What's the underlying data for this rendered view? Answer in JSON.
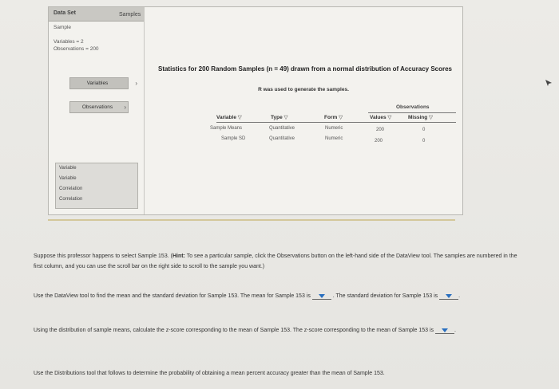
{
  "data_view": {
    "headers": {
      "data_set": "Data Set",
      "samples": "Samples"
    },
    "dataset_name": "Sample",
    "variables_line": "Variables = 2",
    "observations_line": "Observations = 200",
    "variables_button": "Variables",
    "observations_button": "Observations",
    "list_items": [
      "Variable",
      "Variable",
      "Correlation",
      "Correlation"
    ],
    "title": "Statistics for 200 Random Samples (n = 49) drawn from a normal distribution of Accuracy Scores",
    "subtitle": "R was used to generate the samples.",
    "observations_header": "Observations",
    "columns": [
      "Variable",
      "Type",
      "Form",
      "Values",
      "Missing"
    ],
    "rows": [
      {
        "variable": "Sample Means",
        "type": "Quantitative",
        "form": "Numeric",
        "values": "200",
        "missing": "0"
      },
      {
        "variable": "Sample SD",
        "type": "Quantitative",
        "form": "Numeric",
        "values": "200",
        "missing": "0"
      }
    ]
  },
  "questions": {
    "q1_a": "Suppose this professor happens to select Sample 153. (",
    "q1_hint": "Hint:",
    "q1_b": " To see a particular sample, click the Observations button on the left-hand side of the DataView tool. The samples are numbered in the first column, and you can use the scroll bar on the right side to scroll to the sample you want.)",
    "q2_a": "Use the DataView tool to find the mean and the standard deviation for Sample 153. The mean for Sample 153 is",
    "q2_b": ". The standard deviation for Sample 153 is",
    "q2_c": ".",
    "q3_a": "Using the distribution of sample means, calculate the z-score corresponding to the mean of Sample 153. The z-score corresponding to the mean of Sample 153 is",
    "q3_b": ".",
    "q4": "Use the Distributions tool that follows to determine the probability of obtaining a mean percent accuracy greater than the mean of Sample 153."
  },
  "colors": {
    "accent_dropdown": "#2a6fbf",
    "divider": "#d3c79a"
  }
}
